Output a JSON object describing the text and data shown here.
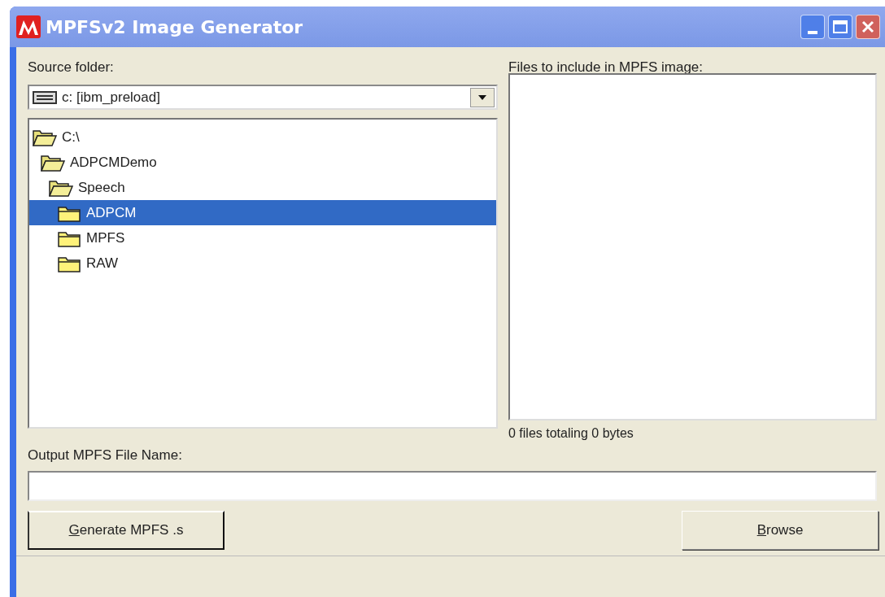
{
  "window": {
    "title": "MPFSv2 Image Generator"
  },
  "source_folder": {
    "label": "Source folder:",
    "drive": "c: [ibm_preload]"
  },
  "folder_tree": [
    {
      "label": "C:\\",
      "expanded": true,
      "selected": false,
      "children": [
        {
          "label": "ADPCMDemo",
          "expanded": true,
          "selected": false,
          "children": [
            {
              "label": "Speech",
              "expanded": true,
              "selected": false,
              "children": [
                {
                  "label": "ADPCM",
                  "expanded": false,
                  "selected": true
                },
                {
                  "label": "MPFS",
                  "expanded": false,
                  "selected": false
                },
                {
                  "label": "RAW",
                  "expanded": false,
                  "selected": false
                }
              ]
            }
          ]
        }
      ]
    }
  ],
  "files": {
    "label": "Files to include in MPFS image:",
    "summary": "0 files totaling 0 bytes"
  },
  "output": {
    "label": "Output MPFS File Name:"
  },
  "buttons": [
    {
      "label": "Generate MPFS .s",
      "kind": "default"
    },
    {
      "label": "Browse",
      "kind": "normal"
    }
  ]
}
